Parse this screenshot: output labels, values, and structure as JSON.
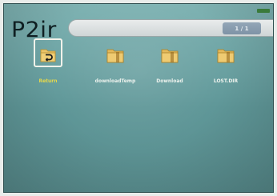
{
  "header": {
    "logo_text": "P2ir",
    "page_indicator": "1 / 1"
  },
  "files": [
    {
      "label": "Return",
      "icon": "return-folder-icon",
      "selected": true
    },
    {
      "label": "downloadTemp",
      "icon": "folder-icon",
      "selected": false
    },
    {
      "label": "Download",
      "icon": "folder-icon",
      "selected": false
    },
    {
      "label": "LOST.DIR",
      "icon": "folder-icon",
      "selected": false
    }
  ],
  "colors": {
    "background": "#6aa3a4",
    "selected_label": "#e6d84a",
    "label": "#eef3ee",
    "folder": "#e9c46a"
  }
}
